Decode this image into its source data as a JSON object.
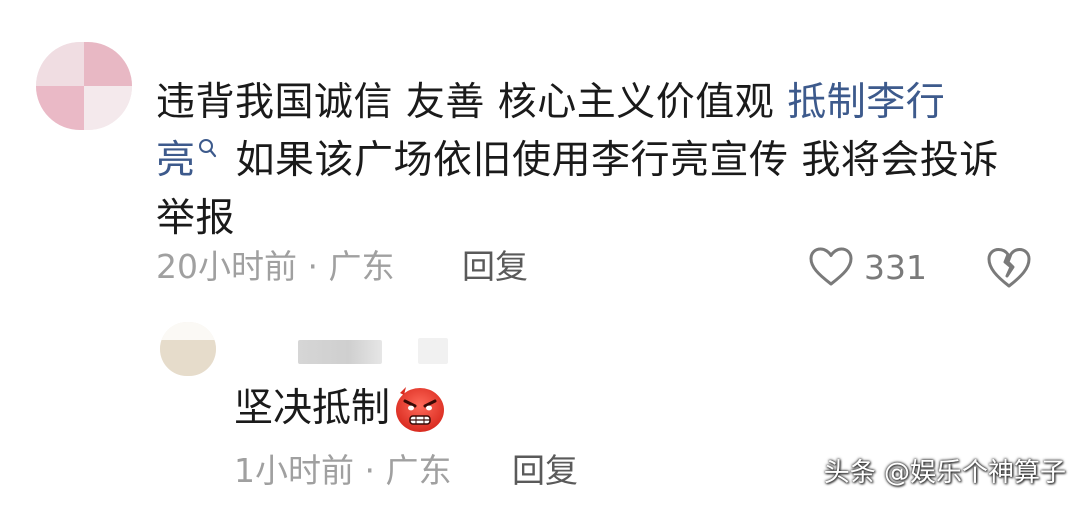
{
  "comment": {
    "text_part1": "违背我国诚信 友善  核心主义价值观 ",
    "link_text_a": "抵制李行",
    "link_text_b": "亮",
    "text_part2": "如果该广场依旧使用李行亮宣传 我将会投诉举报",
    "time_location": "20小时前 · 广东",
    "reply_label": "回复",
    "like_count": "331",
    "like_icon": "heart-outline-icon",
    "dislike_icon": "broken-heart-icon",
    "search_icon": "search-icon"
  },
  "reply": {
    "text": "坚决抵制",
    "emoji": "angry-face-emoji",
    "time_location": "1小时前 · 广东",
    "reply_label": "回复"
  },
  "watermark": "头条 @娱乐个神算子"
}
